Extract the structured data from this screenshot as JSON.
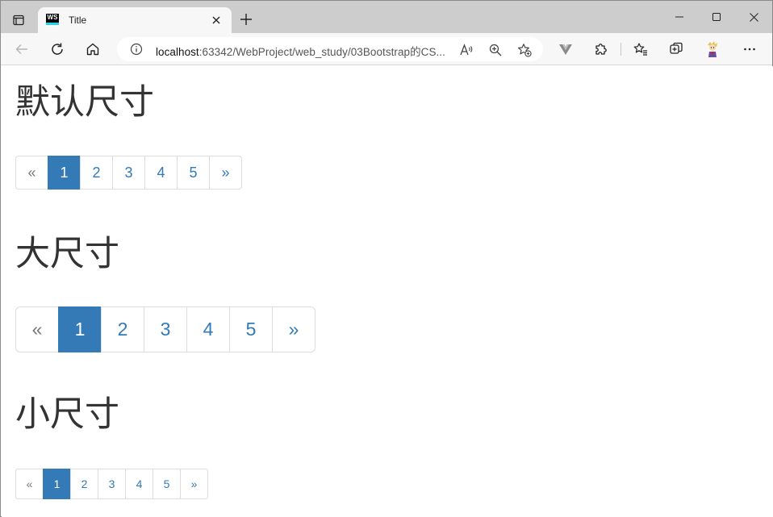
{
  "browser": {
    "tab": {
      "title": "Title",
      "favicon_text": "WS"
    },
    "address": {
      "host": "localhost",
      "rest": ":63342/WebProject/web_study/03Bootstrap的CS..."
    }
  },
  "page": {
    "sections": [
      {
        "title": "默认尺寸",
        "pagination": {
          "prev": "«",
          "pages": [
            "1",
            "2",
            "3",
            "4",
            "5"
          ],
          "next": "»",
          "active": "1"
        }
      },
      {
        "title": "大尺寸",
        "pagination": {
          "prev": "«",
          "pages": [
            "1",
            "2",
            "3",
            "4",
            "5"
          ],
          "next": "»",
          "active": "1"
        }
      },
      {
        "title": "小尺寸",
        "pagination": {
          "prev": "«",
          "pages": [
            "1",
            "2",
            "3",
            "4",
            "5"
          ],
          "next": "»",
          "active": "1"
        }
      }
    ]
  },
  "colors": {
    "link": "#337ab7",
    "active_bg": "#337ab7",
    "border": "#dddddd",
    "heading": "#333333"
  }
}
